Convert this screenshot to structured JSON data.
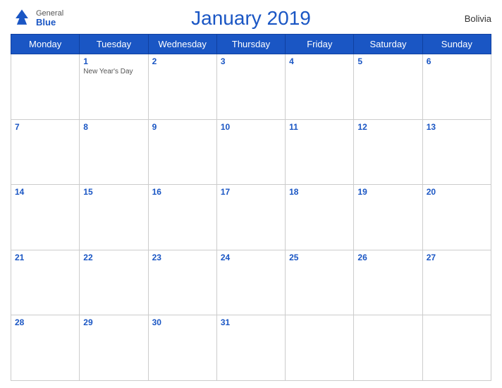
{
  "header": {
    "title": "January 2019",
    "country": "Bolivia",
    "logo": {
      "general": "General",
      "blue": "Blue"
    }
  },
  "weekdays": [
    "Monday",
    "Tuesday",
    "Wednesday",
    "Thursday",
    "Friday",
    "Saturday",
    "Sunday"
  ],
  "weeks": [
    [
      {
        "day": "",
        "empty": true
      },
      {
        "day": "1",
        "holiday": "New Year's Day"
      },
      {
        "day": "2"
      },
      {
        "day": "3"
      },
      {
        "day": "4"
      },
      {
        "day": "5"
      },
      {
        "day": "6"
      }
    ],
    [
      {
        "day": "7"
      },
      {
        "day": "8"
      },
      {
        "day": "9"
      },
      {
        "day": "10"
      },
      {
        "day": "11"
      },
      {
        "day": "12"
      },
      {
        "day": "13"
      }
    ],
    [
      {
        "day": "14"
      },
      {
        "day": "15"
      },
      {
        "day": "16"
      },
      {
        "day": "17"
      },
      {
        "day": "18"
      },
      {
        "day": "19"
      },
      {
        "day": "20"
      }
    ],
    [
      {
        "day": "21"
      },
      {
        "day": "22"
      },
      {
        "day": "23"
      },
      {
        "day": "24"
      },
      {
        "day": "25"
      },
      {
        "day": "26"
      },
      {
        "day": "27"
      }
    ],
    [
      {
        "day": "28"
      },
      {
        "day": "29"
      },
      {
        "day": "30"
      },
      {
        "day": "31"
      },
      {
        "day": "",
        "empty": true
      },
      {
        "day": "",
        "empty": true
      },
      {
        "day": "",
        "empty": true
      }
    ]
  ]
}
